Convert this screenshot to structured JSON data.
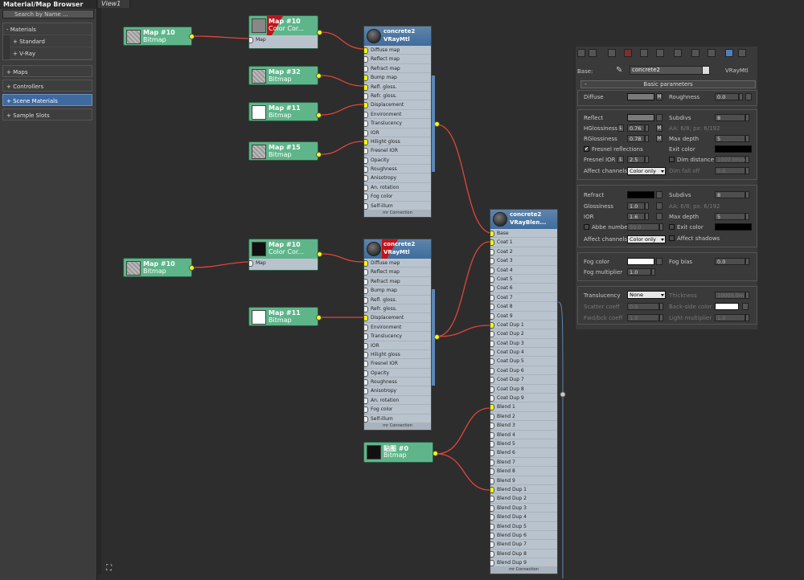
{
  "browser": {
    "title": "Material/Map Browser",
    "search_placeholder": "Search by Name ...",
    "groups": [
      {
        "label": "- Materials",
        "items": [
          "+ Standard",
          "+ V-Ray"
        ]
      },
      {
        "label": "+ Maps"
      },
      {
        "label": "+ Controllers"
      },
      {
        "label": "+ Scene Materials"
      },
      {
        "label": "+ Sample Slots"
      }
    ]
  },
  "view": {
    "tab": "View1"
  },
  "nodes": {
    "bm_top": {
      "name": "Map #10",
      "type": "Bitmap"
    },
    "cc_top": {
      "name": "Map #10",
      "type": "Color Cor...",
      "slot": "Map"
    },
    "bm32": {
      "name": "Map #32",
      "type": "Bitmap"
    },
    "bm11_top": {
      "name": "Map #11",
      "type": "Bitmap"
    },
    "bm15": {
      "name": "Map #15",
      "type": "Bitmap"
    },
    "bm_mid": {
      "name": "Map #10",
      "type": "Bitmap"
    },
    "cc_mid": {
      "name": "Map #10",
      "type": "Color Cor...",
      "slot": "Map"
    },
    "bm11_mid": {
      "name": "Map #11",
      "type": "Bitmap"
    },
    "bm0": {
      "name": "贴图 #0",
      "type": "Bitmap"
    },
    "mat1": {
      "name": "concrete2",
      "type": "VRayMtl"
    },
    "mat2": {
      "name": "concrete2",
      "type": "VRayMtl"
    },
    "blend": {
      "name": "concrete2",
      "type": "VRayBlen..."
    }
  },
  "vray_slots": [
    "Diffuse map",
    "Reflect map",
    "Refract map",
    "Bump map",
    "Refl. gloss.",
    "Refr. gloss.",
    "Displacement",
    "Environment",
    "Translucency",
    "IOR",
    "Hilight gloss",
    "Fresnel IOR",
    "Opacity",
    "Roughness",
    "Anisotropy",
    "An. rotation",
    "Fog color",
    "Self-illum"
  ],
  "mr_connection": "mr Connection",
  "blend_slots": [
    "Base",
    "Coat 1",
    "Coat 2",
    "Coat 3",
    "Coat 4",
    "Coat 5",
    "Coat 6",
    "Coat 7",
    "Coat 8",
    "Coat 9",
    "Coat Dup 1",
    "Coat Dup 2",
    "Coat Dup 3",
    "Coat Dup 4",
    "Coat Dup 5",
    "Coat Dup 6",
    "Coat Dup 7",
    "Coat Dup 8",
    "Coat Dup 9",
    "Blend 1",
    "Blend 2",
    "Blend 3",
    "Blend 4",
    "Blend 5",
    "Blend 6",
    "Blend 7",
    "Blend 8",
    "Blend 9",
    "Blend Dup 1",
    "Blend Dup 2",
    "Blend Dup 3",
    "Blend Dup 4",
    "Blend Dup 5",
    "Blend Dup 6",
    "Blend Dup 7",
    "Blend Dup 8",
    "Blend Dup 9"
  ],
  "panel": {
    "base_label": "Base:",
    "base_value": "concrete2",
    "base_type": "VRayMtl",
    "rollout": "Basic parameters",
    "diffuse": "Diffuse",
    "m": "M",
    "roughness": "Roughness",
    "roughness_val": "0.0",
    "reflect": "Reflect",
    "subdivs": "Subdivs",
    "subdivs_val": "8",
    "hgloss": "HGlossiness",
    "hgloss_val": "0.76",
    "l": "L",
    "aa": "AA: 6/8; px: 6/192",
    "rgloss": "RGlossiness",
    "rgloss_val": "0.78",
    "maxdepth": "Max depth",
    "maxdepth_val": "5",
    "fresnel": "Fresnel reflections",
    "exitcolor": "Exit color",
    "fresnel_ior": "Fresnel IOR",
    "fresnel_ior_val": "2.5",
    "dimdist": "Dim distance",
    "dimdist_val": "1000.0mm",
    "affect": "Affect channels",
    "coloronly": "Color only",
    "dimfall": "Dim fall off",
    "dimfall_val": "0.0",
    "refract": "Refract",
    "glossiness": "Glossiness",
    "glossiness_val": "1.0",
    "ior": "IOR",
    "ior_val": "1.6",
    "abbe": "Abbe number",
    "abbe_val": "50.0",
    "affect_shadows": "Affect shadows",
    "fogcolor": "Fog color",
    "fogbias": "Fog bias",
    "fogbias_val": "0.0",
    "fogmult": "Fog multiplier",
    "fogmult_val": "1.0",
    "translucency": "Translucency",
    "trans_val": "None",
    "thickness": "Thickness",
    "thickness_val": "10000.0m",
    "scatter": "Scatter coeff",
    "scatter_val": "0.0",
    "backside": "Back-side color",
    "fwdbck": "Fwd/bck coeff",
    "fwdbck_val": "1.0",
    "lightmult": "Light multiplier",
    "lightmult_val": "1.0"
  },
  "colors": {
    "map_node": "#5eb58a",
    "mat_header": "#3f6d9c",
    "wire": "#e0443c",
    "port": "#f5ff00",
    "selection": "#3f6aa0"
  }
}
